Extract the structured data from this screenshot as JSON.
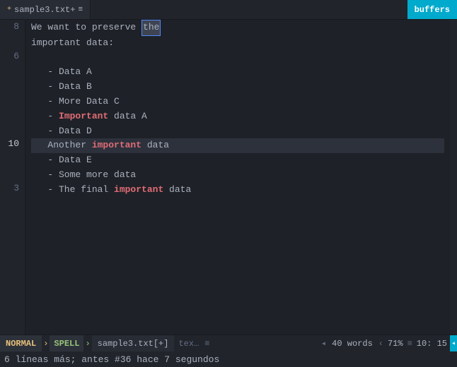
{
  "tab": {
    "filename": "sample3.txt+",
    "menu_icon": "≡",
    "buffers_label": "buffers"
  },
  "lines": [
    {
      "num": "8",
      "text": "We want to preserve the",
      "parts": [
        {
          "text": "We want to preserve ",
          "class": ""
        },
        {
          "text": "the",
          "class": "highlight-word"
        }
      ],
      "current": false
    },
    {
      "num": "",
      "text": "important data:",
      "current": false
    },
    {
      "num": "6",
      "text": "",
      "current": false
    },
    {
      "num": "",
      "text": "   - Data A",
      "current": false
    },
    {
      "num": "",
      "text": "   - Data B",
      "current": false
    },
    {
      "num": "",
      "text": "   - More Data C",
      "current": false
    },
    {
      "num": "",
      "text": "   - Important data A",
      "current": false
    },
    {
      "num": "",
      "text": "   - Data D",
      "current": false
    },
    {
      "num": "10",
      "text": "   Another important data",
      "current": true
    },
    {
      "num": "",
      "text": "   - Data E",
      "current": false
    },
    {
      "num": "",
      "text": "   - Some more data",
      "current": false
    },
    {
      "num": "3",
      "text": "   - The final important data",
      "current": false
    }
  ],
  "status": {
    "mode": "NORMAL",
    "chevron1": "›",
    "spell": "SPELL",
    "chevron2": "›",
    "filename": "sample3.txt[+]",
    "filetype": "tex…",
    "menu_icon": "≡",
    "words": "40 words",
    "chevron_left1": "‹",
    "percent": "71%",
    "lines_icon": "≡",
    "position": "10:  15",
    "end_icon": "◂"
  },
  "bottom_message": "6 líneas más; antes #36  hace 7 segundos"
}
